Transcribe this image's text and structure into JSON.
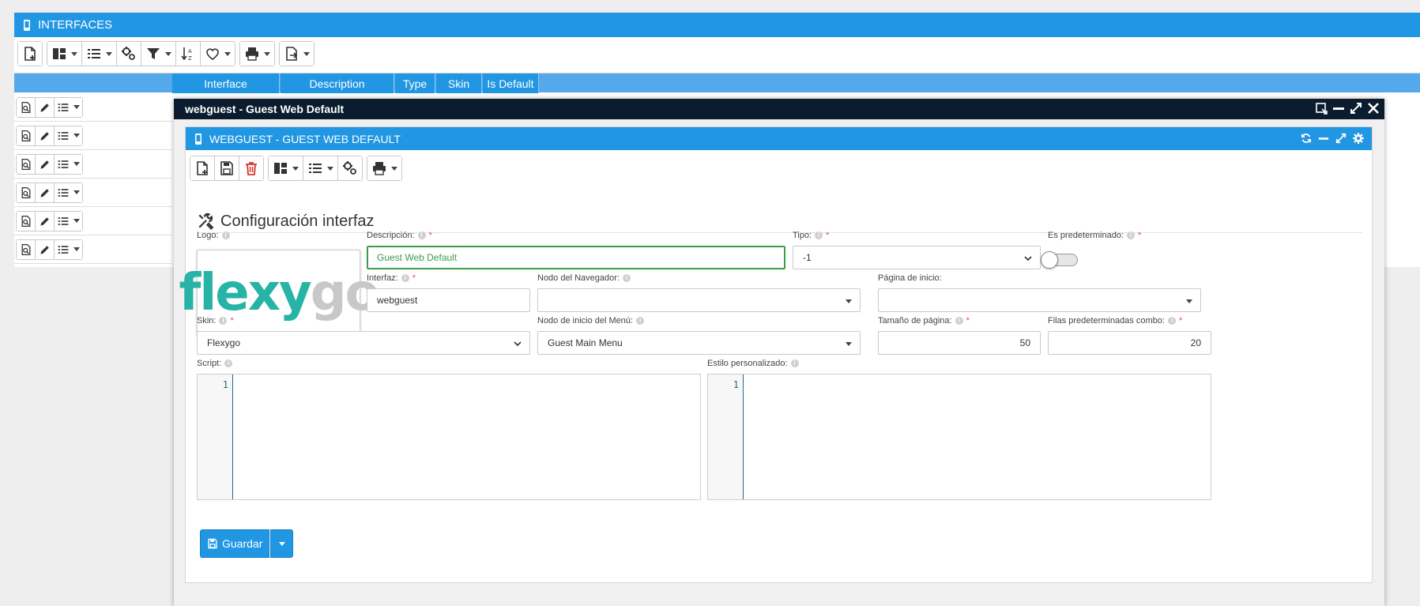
{
  "background": {
    "title": "INTERFACES",
    "grid_columns": [
      "Interface",
      "Description",
      "Type",
      "Skin",
      "Is Default"
    ],
    "row_count": 6
  },
  "modal": {
    "title": "webguest - Guest Web Default",
    "inner_title": "WEBGUEST - GUEST WEB DEFAULT",
    "section_title": "Configuración interfaz",
    "fields": {
      "logo": {
        "label": "Logo:",
        "logo_part1": "flexy",
        "logo_part2": "go"
      },
      "descripcion": {
        "label": "Descripción:",
        "value": "Guest Web Default"
      },
      "tipo": {
        "label": "Tipo:",
        "value": "-1"
      },
      "es_predeterminado": {
        "label": "Es predeterminado:",
        "value": false
      },
      "interfaz": {
        "label": "Interfaz:",
        "value": "webguest"
      },
      "nodo_navegador": {
        "label": "Nodo del Navegador:",
        "value": ""
      },
      "pagina_inicio": {
        "label": "Página de inicio:",
        "value": ""
      },
      "skin": {
        "label": "Skin:",
        "value": "Flexygo"
      },
      "nodo_menu": {
        "label": "Nodo de inicio del Menú:",
        "value": "Guest Main Menu"
      },
      "tamano_pagina": {
        "label": "Tamaño de página:",
        "value": "50"
      },
      "filas_combo": {
        "label": "Filas predeterminadas combo:",
        "value": "20"
      },
      "script": {
        "label": "Script:",
        "line": "1"
      },
      "estilo": {
        "label": "Estilo personalizado:",
        "line": "1"
      }
    },
    "save_label": "Guardar"
  },
  "colors": {
    "primary": "#2196e3",
    "modal_title_bg": "#0a1c2e",
    "focus_green": "#3a9d48",
    "delete_red": "#d9342b",
    "logo_teal": "#27b3a5"
  }
}
